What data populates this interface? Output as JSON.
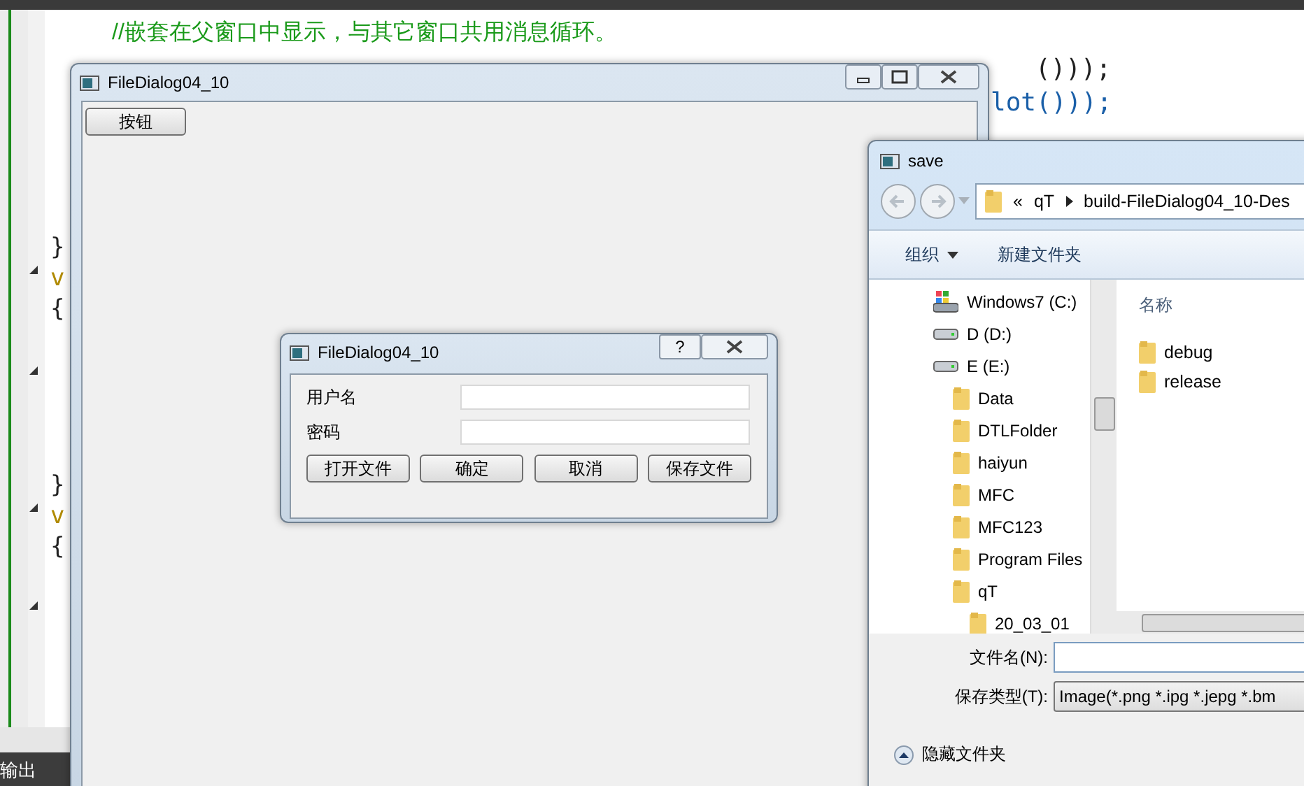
{
  "editor": {
    "comment_line": "//嵌套在父窗口中显示，与其它窗口共用消息循环。",
    "code_tail_lines": [
      "()));",
      "lot()));"
    ],
    "left_fragments": [
      {
        "text": "}",
        "kind": "brace"
      },
      {
        "text": "v",
        "kind": "keyword"
      },
      {
        "text": "{",
        "kind": "brace"
      },
      {
        "text": "}",
        "kind": "brace"
      },
      {
        "text": "v",
        "kind": "keyword"
      },
      {
        "text": "{",
        "kind": "brace"
      }
    ],
    "output_tab": "输出"
  },
  "main_window": {
    "title": "FileDialog04_10",
    "button": "按钮"
  },
  "dialog": {
    "title": "FileDialog04_10",
    "help": "?",
    "fields": [
      {
        "label": "用户名"
      },
      {
        "label": "密码"
      }
    ],
    "buttons": [
      "打开文件",
      "确定",
      "取消",
      "保存文件"
    ]
  },
  "save_dialog": {
    "title": "save",
    "breadcrumb": [
      "«",
      "qT",
      "build-FileDialog04_10-Des"
    ],
    "toolbar": [
      {
        "label": "组织",
        "dropdown": true
      },
      {
        "label": "新建文件夹",
        "dropdown": false
      }
    ],
    "tree": [
      {
        "label": "Windows7 (C:)",
        "kind": "system-drive"
      },
      {
        "label": "D (D:)",
        "kind": "drive"
      },
      {
        "label": "E (E:)",
        "kind": "drive",
        "children": [
          {
            "label": "Data",
            "kind": "folder"
          },
          {
            "label": "DTLFolder",
            "kind": "folder"
          },
          {
            "label": "haiyun",
            "kind": "folder"
          },
          {
            "label": "MFC",
            "kind": "folder"
          },
          {
            "label": "MFC123",
            "kind": "folder"
          },
          {
            "label": "Program Files",
            "kind": "folder"
          },
          {
            "label": "qT",
            "kind": "folder",
            "children": [
              {
                "label": "20_03_01",
                "kind": "folder"
              }
            ]
          }
        ]
      }
    ],
    "list_header": "名称",
    "files": [
      "debug",
      "release"
    ],
    "filename_label": "文件名(N):",
    "filetype_label": "保存类型(T):",
    "filetype_value": "Image(*.png *.ipg *.jepg *.bm",
    "hide_folders": "隐藏文件夹"
  }
}
